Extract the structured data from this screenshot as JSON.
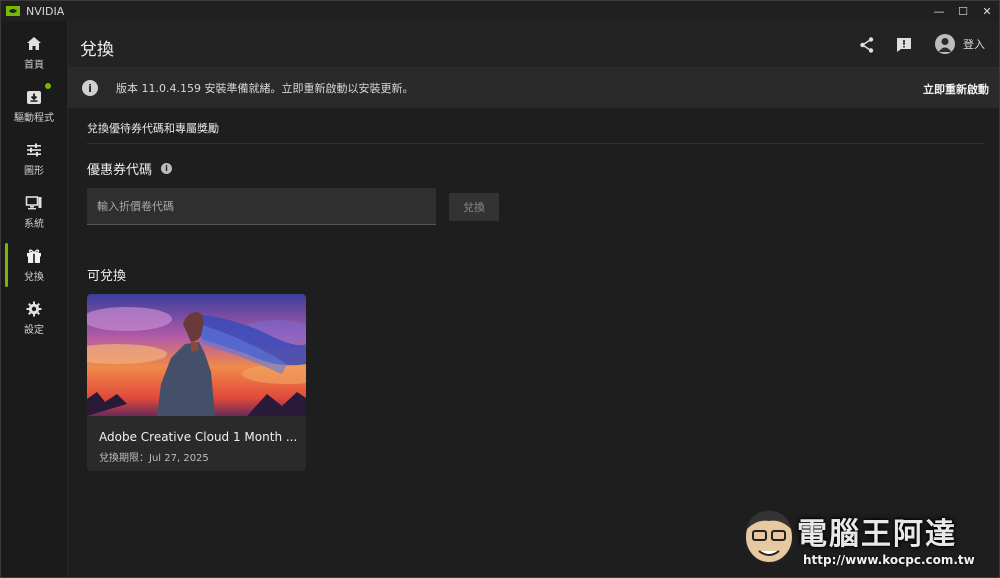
{
  "app": {
    "title": "NVIDIA",
    "accent": "#76b900"
  },
  "window_controls": {
    "minimize": "—",
    "maximize": "☐",
    "close": "✕"
  },
  "sidebar": {
    "items": [
      {
        "label": "首頁",
        "icon": "home-icon"
      },
      {
        "label": "驅動程式",
        "icon": "driver-download-icon"
      },
      {
        "label": "圖形",
        "icon": "sliders-icon"
      },
      {
        "label": "系統",
        "icon": "monitor-icon"
      },
      {
        "label": "兌換",
        "icon": "gift-icon",
        "active": true
      },
      {
        "label": "設定",
        "icon": "gear-icon"
      }
    ]
  },
  "header": {
    "title": "兌換",
    "login_label": "登入"
  },
  "banner": {
    "message": "版本 11.0.4.159 安裝準備就緒。立即重新啟動以安裝更新。",
    "action": "立即重新啟動"
  },
  "main": {
    "section_title": "兌換優待券代碼和專屬獎勵",
    "coupon": {
      "label": "優惠券代碼",
      "placeholder": "輸入折價卷代碼",
      "button": "兌換"
    },
    "available": {
      "label": "可兌換",
      "cards": [
        {
          "title": "Adobe Creative Cloud 1 Month ...",
          "expiry": "兌換期限：Jul 27, 2025"
        }
      ]
    }
  },
  "watermark": {
    "text": "電腦王阿達",
    "url": "http://www.kocpc.com.tw"
  }
}
